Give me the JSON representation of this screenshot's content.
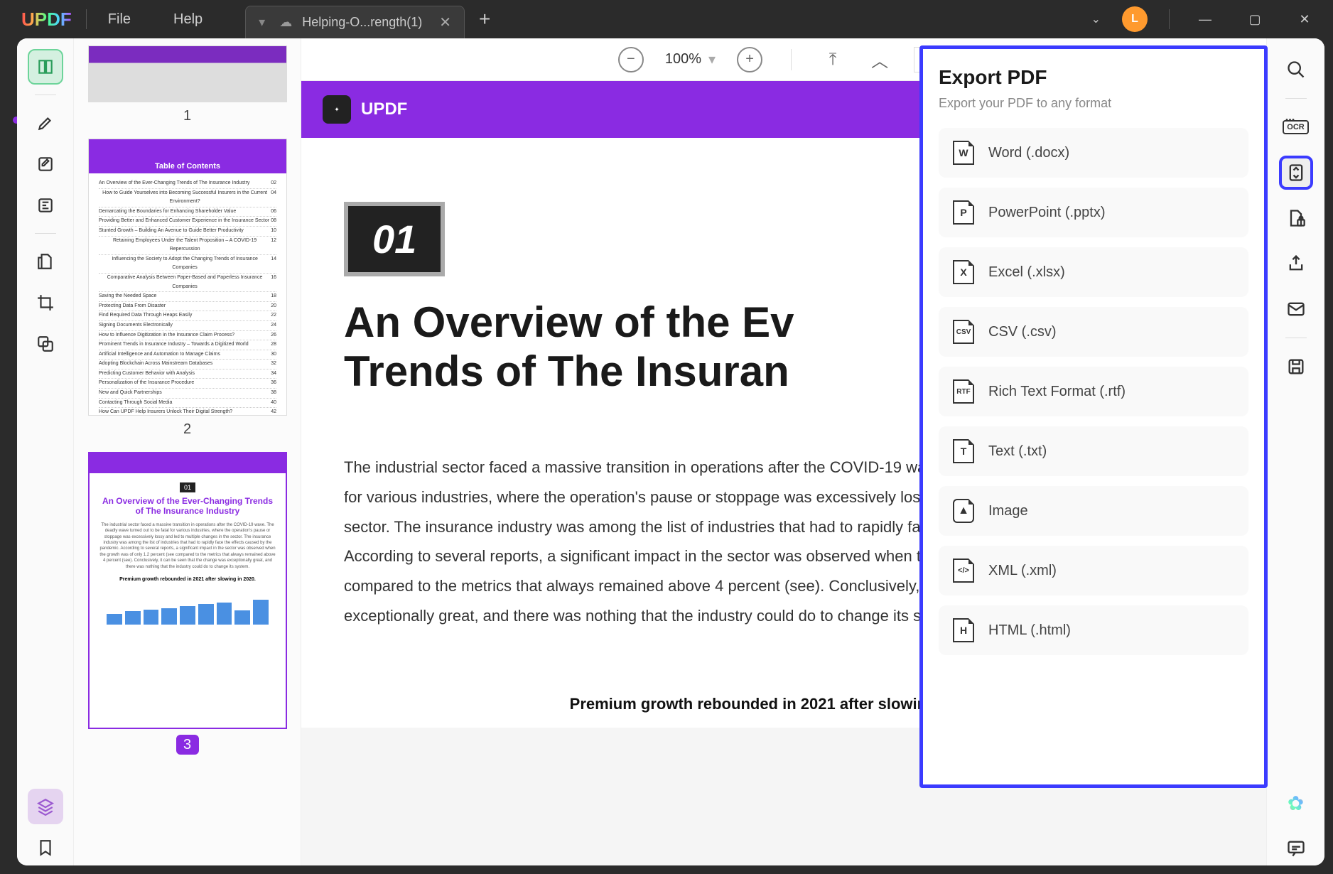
{
  "menu": {
    "file": "File",
    "help": "Help"
  },
  "tab": {
    "name": "Helping-O...rength(1)"
  },
  "avatar": {
    "initial": "L"
  },
  "zoom": {
    "value": "100%"
  },
  "thumbs": {
    "n1": "1",
    "n2": "2",
    "n3": "3",
    "toc_title": "Table of Contents",
    "t3_badge": "01",
    "t3_title": "An Overview of the Ever-Changing Trends of The Insurance Industry"
  },
  "doc": {
    "brand": "UPDF",
    "chapter": "01",
    "title1": "An Overview of the Ev",
    "title2": "Trends of The Insuran",
    "body": "The industrial sector faced a massive transition in operations after the COVID-19 wave. The deadly wave turned out to be fatal for various industries, where the operation's pause or stoppage was excessively lossy and led to multiple changes in the sector. The insurance industry was among the list of industries that had to rapidly face the effects caused by the pandemic. According to several reports, a significant impact in the sector was observed when the growth was of only 1.2 percent (see compared to the metrics that always remained above 4 percent (see). Conclusively, it can be seen that the change was exceptionally great, and there was nothing that the industry could do to change its system.",
    "sub": "Premium growth rebounded in 2021 after slowing in 2020."
  },
  "export": {
    "title": "Export PDF",
    "sub": "Export your PDF to any format",
    "word": "Word (.docx)",
    "ppt": "PowerPoint (.pptx)",
    "xlsx": "Excel (.xlsx)",
    "csv": "CSV (.csv)",
    "rtf": "Rich Text Format (.rtf)",
    "txt": "Text (.txt)",
    "img": "Image",
    "xml": "XML (.xml)",
    "html": "HTML (.html)"
  },
  "toc": [
    "An Overview of the Ever-Changing Trends of The Insurance Industry",
    "How to Guide Yourselves into Becoming Successful Insurers in the Current Environment?",
    "Demarcating the Boundaries for Enhancing Shareholder Value",
    "Providing Better and Enhanced Customer Experience in the Insurance Sector",
    "Stunted Growth – Building An Avenue to Guide Better Productivity",
    "Retaining Employees Under the Talent Proposition – A COVID-19 Repercussion",
    "Influencing the Society to Adopt the Changing Trends of Insurance Companies",
    "Comparative Analysis Between Paper-Based and Paperless Insurance Companies",
    "Saving the Needed Space",
    "Protecting Data From Disaster",
    "Find Required Data Through Heaps Easily",
    "Signing Documents Electronically",
    "How to Influence Digitization in the Insurance Claim Process?",
    "Prominent Trends in Insurance Industry – Towards a Digitized World",
    "Artificial Intelligence and Automation to Manage Claims",
    "Adopting Blockchain Across Mainstream Databases",
    "Predicting Customer Behavior with Analysis",
    "Personalization of the Insurance Procedure",
    "New and Quick Partnerships",
    "Contacting Through Social Media",
    "How Can UPDF Help Insurers Unlock Their Digital Strength?"
  ]
}
